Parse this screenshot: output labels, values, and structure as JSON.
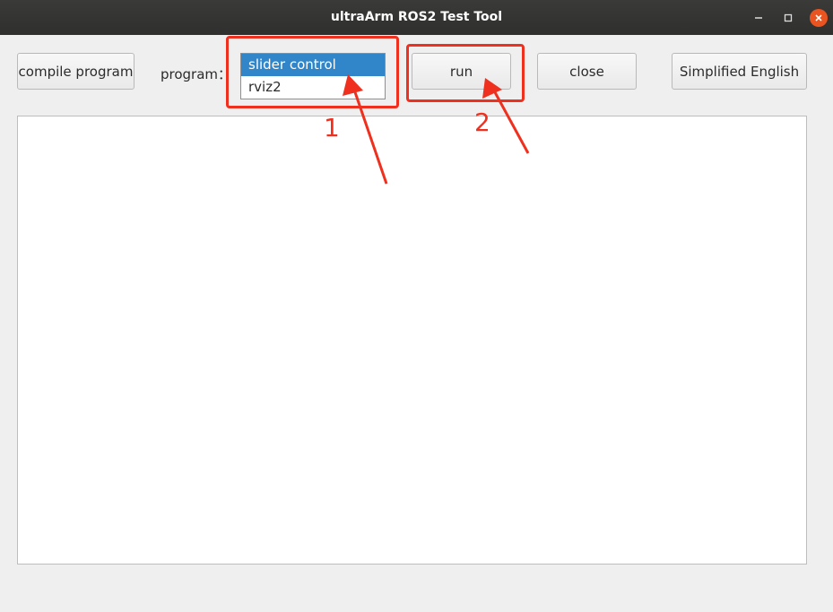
{
  "window": {
    "title": "ultraArm ROS2 Test Tool"
  },
  "toolbar": {
    "compile_label": "compile program",
    "program_label": "program：",
    "program_options": [
      "slider control",
      "rviz2"
    ],
    "selected_option": "slider control",
    "run_label": "run",
    "close_label": "close",
    "language_label": "Simplified English"
  },
  "annotations": {
    "step1": "1",
    "step2": "2",
    "color": "#f0301f"
  },
  "icons": {
    "minimize": "minimize-icon",
    "maximize": "maximize-icon",
    "close": "close-icon"
  }
}
